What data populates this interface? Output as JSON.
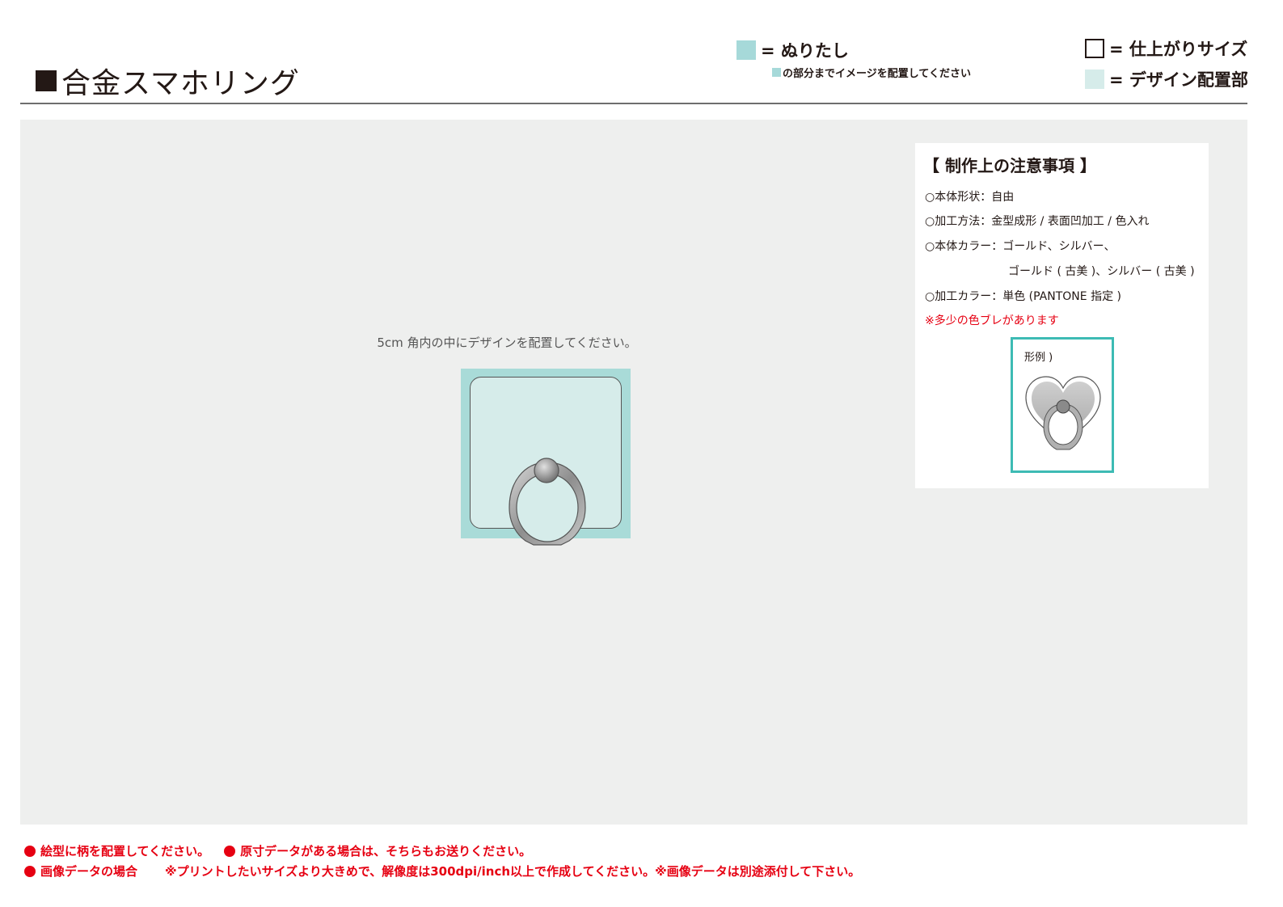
{
  "header": {
    "title": "合金スマホリング",
    "legend_bleed_label": "= ぬりたし",
    "legend_bleed_sub": "の部分までイメージを配置してください",
    "legend_finish_label": "= 仕上がりサイズ",
    "legend_design_label": "= デザイン配置部"
  },
  "canvas": {
    "instruction": "5cm 角内の中にデザインを配置してください。"
  },
  "notes": {
    "title": "【 制作上の注意事項 】",
    "lines": [
      "○本体形状：自由",
      "○加工方法：金型成形 / 表面凹加工 / 色入れ",
      "○本体カラー：ゴールド、シルバー、",
      "ゴールド ( 古美 )、シルバー ( 古美 )",
      "○加工カラー：単色 (PANTONE 指定 )"
    ],
    "warning": "※多少の色ブレがあります",
    "example_label": "形例 )"
  },
  "footer": {
    "line1_part1": "絵型に柄を配置してください。",
    "line1_part2": "原寸データがある場合は、そちらもお送りください。",
    "line2_part1": "画像データの場合",
    "line2_part2": "※プリントしたいサイズより大きめで、解像度は300dpi/inch以上で作成してください。※画像データは別途添付して下さい。"
  },
  "colors": {
    "bleed": "#a6d9d9",
    "design_area": "#d6ecea",
    "canvas_bg": "#eeefee",
    "accent_teal": "#3dbbb4",
    "warning_red": "#e60012"
  }
}
